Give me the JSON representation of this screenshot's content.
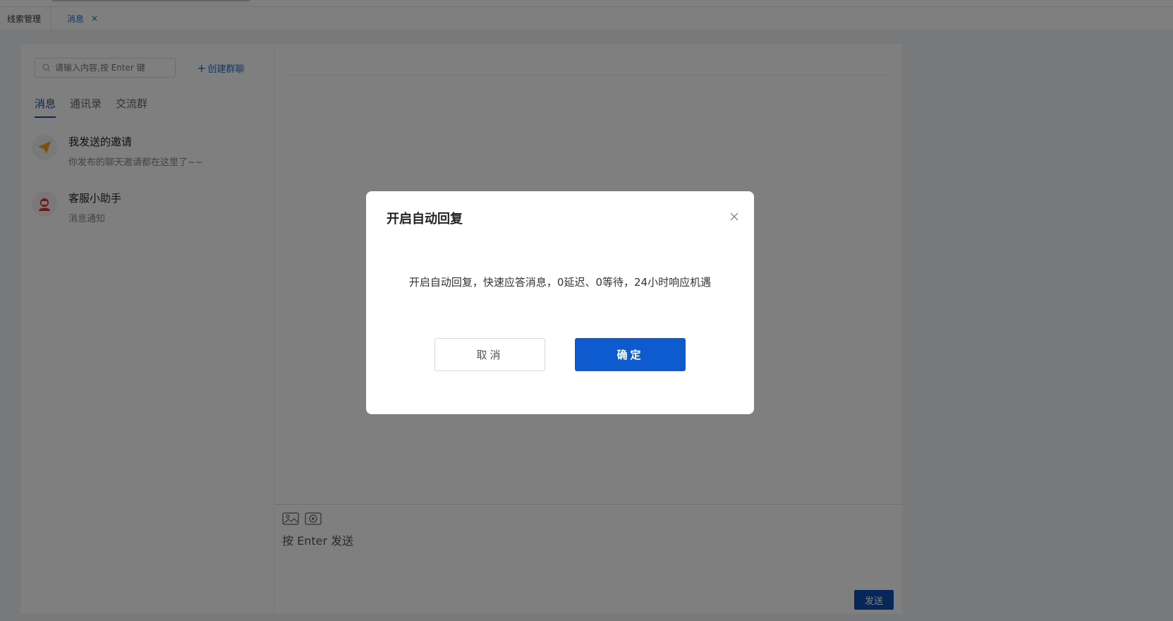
{
  "tabs": {
    "first_label": "线索管理",
    "active_label": "消息",
    "active_close": "×"
  },
  "sidebar": {
    "search_placeholder": "请输入内容,按 Enter 键",
    "create_group_plus": "+",
    "create_group_label": "创建群聊",
    "tabs": [
      "消息",
      "通讯录",
      "交流群"
    ],
    "conversations": [
      {
        "name": "我发送的邀请",
        "preview": "你发布的聊天邀请都在这里了~~",
        "icon": "paper-plane-icon"
      },
      {
        "name": "客服小助手",
        "preview": "消息通知",
        "icon": "customer-service-icon"
      }
    ]
  },
  "chat": {
    "input_placeholder": "按 Enter 发送",
    "send_label": "发送",
    "tools": [
      "image-icon",
      "video-icon"
    ]
  },
  "dialog": {
    "title": "开启自动回复",
    "body": "开启自动回复，快速应答消息，0延迟、0等待，24小时响应机遇",
    "cancel_label": "取消",
    "ok_label": "确定"
  },
  "colors": {
    "accent": "#0e5bd0",
    "tab_active": "#1f6fd1",
    "send": "#0e4fb5"
  }
}
